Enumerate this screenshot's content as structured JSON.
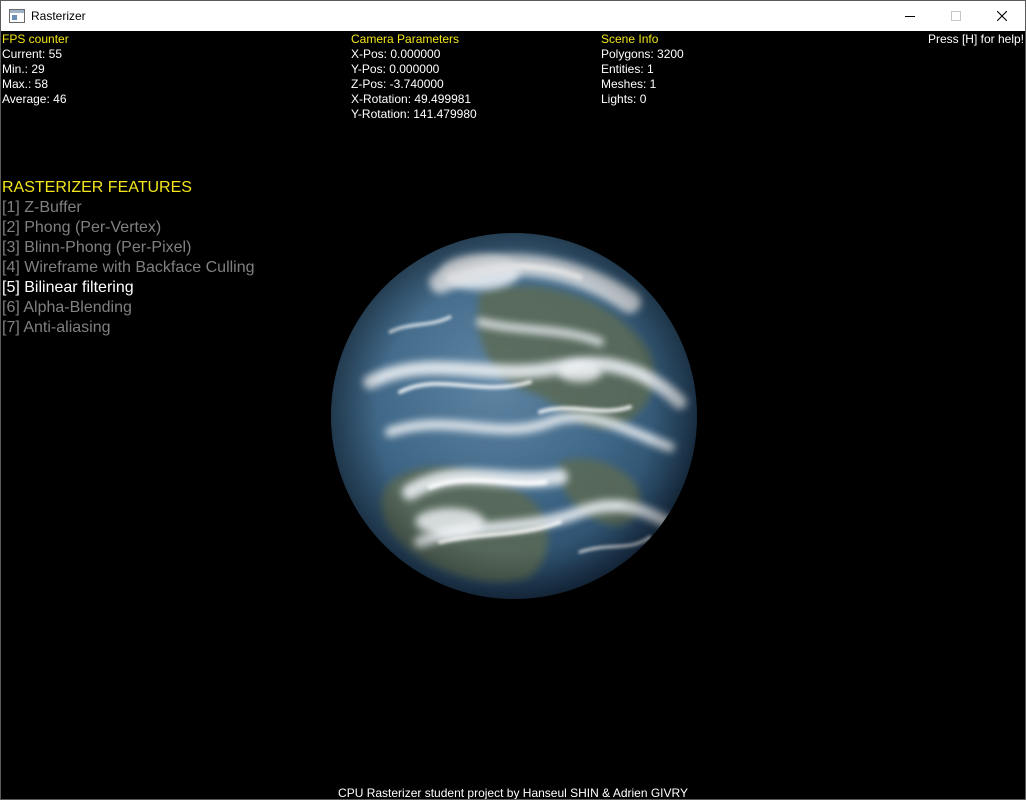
{
  "window": {
    "title": "Rasterizer",
    "icon": "app-window-icon",
    "controls": [
      "minimize-icon",
      "maximize-icon",
      "close-icon"
    ]
  },
  "fps": {
    "heading": "FPS counter",
    "current": "Current: 55",
    "min": "Min.: 29",
    "max": "Max.: 58",
    "average": "Average: 46"
  },
  "camera": {
    "heading": "Camera Parameters",
    "x_pos": "X-Pos: 0.000000",
    "y_pos": "Y-Pos: 0.000000",
    "z_pos": "Z-Pos: -3.740000",
    "x_rot": "X-Rotation: 49.499981",
    "y_rot": "Y-Rotation: 141.479980"
  },
  "scene": {
    "heading": "Scene Info",
    "polygons": "Polygons: 3200",
    "entities": "Entities: 1",
    "meshes": "Meshes: 1",
    "lights": "Lights: 0"
  },
  "help": "Press [H] for help!",
  "features": {
    "title": "RASTERIZER FEATURES",
    "items": [
      {
        "label": "[1] Z-Buffer",
        "active": false
      },
      {
        "label": "[2] Phong (Per-Vertex)",
        "active": false
      },
      {
        "label": "[3] Blinn-Phong (Per-Pixel)",
        "active": false
      },
      {
        "label": "[4] Wireframe with Backface Culling",
        "active": false
      },
      {
        "label": "[5] Bilinear filtering",
        "active": true
      },
      {
        "label": "[6] Alpha-Blending",
        "active": false
      },
      {
        "label": "[7] Anti-aliasing",
        "active": false
      }
    ]
  },
  "credit": "CPU Rasterizer student project by Hanseul SHIN & Adrien GIVRY",
  "colors": {
    "heading": "#f2e61a",
    "inactive_feature": "#808080",
    "active_feature": "#ffffff",
    "background": "#000000"
  }
}
